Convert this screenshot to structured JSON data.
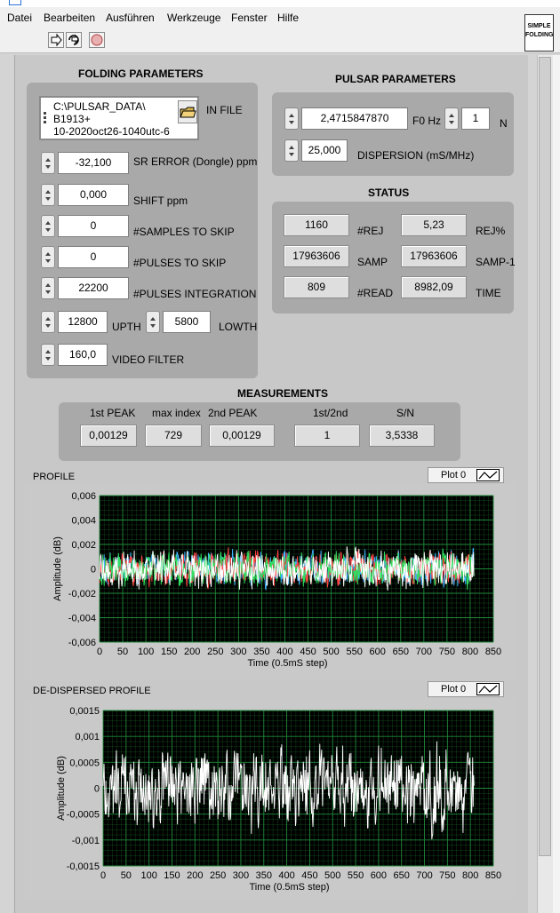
{
  "menu": [
    "Datei",
    "Bearbeiten",
    "Ausführen",
    "Werkzeuge",
    "Fenster",
    "Hilfe"
  ],
  "logo": {
    "line1": "SIMPLE",
    "line2": "FOLDING"
  },
  "folding": {
    "title": "FOLDING PARAMETERS",
    "in_file_label": "IN FILE",
    "in_file_lines": [
      "C:\\PULSAR_DATA\\",
      "B1913+",
      "10-2020oct26-1040utc-6"
    ],
    "sr_error": {
      "value": "-32,100",
      "label": "SR ERROR (Dongle) ppm"
    },
    "shift": {
      "value": "0,000",
      "label": "SHIFT ppm"
    },
    "samples_skip": {
      "value": "0",
      "label": "#SAMPLES TO SKIP"
    },
    "pulses_skip": {
      "value": "0",
      "label": "#PULSES TO SKIP"
    },
    "pulses_integration": {
      "value": "22200",
      "label": "#PULSES INTEGRATION"
    },
    "upth": {
      "value": "12800",
      "label": "UPTH"
    },
    "lowth": {
      "value": "5800",
      "label": "LOWTH"
    },
    "video_filter": {
      "value": "160,0",
      "label": "VIDEO FILTER"
    }
  },
  "pulsar": {
    "title": "PULSAR PARAMETERS",
    "f0": {
      "value": "2,4715847870",
      "label": "F0 Hz"
    },
    "n": {
      "value": "1",
      "label": "N"
    },
    "dispersion": {
      "value": "25,000",
      "label": "DISPERSION (mS/MHz)"
    }
  },
  "status": {
    "title": "STATUS",
    "rej": {
      "value": "1160",
      "label": "#REJ"
    },
    "rej_pct": {
      "value": "5,23",
      "label": "REJ%"
    },
    "samp": {
      "value": "17963606",
      "label": "SAMP"
    },
    "samp1": {
      "value": "17963606",
      "label": "SAMP-1"
    },
    "read": {
      "value": "809",
      "label": "#READ"
    },
    "time": {
      "value": "8982,09",
      "label": "TIME"
    }
  },
  "measurements": {
    "title": "MEASUREMENTS",
    "first_peak": {
      "label": "1st PEAK",
      "value": "0,00129"
    },
    "max_index": {
      "label": "max index",
      "value": "729"
    },
    "second_peak": {
      "label": "2nd PEAK",
      "value": "0,00129"
    },
    "ratio": {
      "label": "1st/2nd",
      "value": "1"
    },
    "sn": {
      "label": "S/N",
      "value": "3,5338"
    }
  },
  "chart_data": [
    {
      "type": "line",
      "title": "PROFILE",
      "legend": "Plot 0",
      "xlabel": "Time (0.5mS step)",
      "ylabel": "Amplitude (dB)",
      "xlim": [
        0,
        850
      ],
      "ylim": [
        -0.006,
        0.006
      ],
      "xticks": [
        0,
        50,
        100,
        150,
        200,
        250,
        300,
        350,
        400,
        450,
        500,
        550,
        600,
        650,
        700,
        750,
        800,
        850
      ],
      "xtick_labels": [
        "0",
        "50",
        "100",
        "150",
        "200",
        "250",
        "300",
        "350",
        "400",
        "450",
        "500",
        "550",
        "600",
        "650",
        "700",
        "750",
        "800",
        "850"
      ],
      "yticks": [
        0.006,
        0.004,
        0.002,
        0,
        -0.002,
        -0.004,
        -0.006
      ],
      "ytick_labels": [
        "0,006",
        "0,004",
        "0,002",
        "0",
        "-0,002",
        "-0,004",
        "-0,006"
      ],
      "grid": true,
      "plot_bg": "#000000",
      "grid_color": "#1f8a3a",
      "series": [
        {
          "color": "#3fb4ff",
          "amplitude": 0.0024,
          "n": 809
        },
        {
          "color": "#ff4040",
          "amplitude": 0.0022,
          "n": 809
        },
        {
          "color": "#30e060",
          "amplitude": 0.0022,
          "n": 809
        },
        {
          "color": "#ffffff",
          "amplitude": 0.0024,
          "n": 809
        }
      ]
    },
    {
      "type": "line",
      "title": "DE-DISPERSED PROFILE",
      "legend": "Plot 0",
      "xlabel": "Time (0.5mS step)",
      "ylabel": "Amplitude (dB)",
      "xlim": [
        0,
        850
      ],
      "ylim": [
        -0.0015,
        0.0015
      ],
      "xticks": [
        0,
        50,
        100,
        150,
        200,
        250,
        300,
        350,
        400,
        450,
        500,
        550,
        600,
        650,
        700,
        750,
        800,
        850
      ],
      "xtick_labels": [
        "0",
        "50",
        "100",
        "150",
        "200",
        "250",
        "300",
        "350",
        "400",
        "450",
        "500",
        "550",
        "600",
        "650",
        "700",
        "750",
        "800",
        "850"
      ],
      "yticks": [
        0.0015,
        0.001,
        0.0005,
        0,
        -0.0005,
        -0.001,
        -0.0015
      ],
      "ytick_labels": [
        "0,0015",
        "0,001",
        "0,0005",
        "0",
        "-0,0005",
        "-0,001",
        "-0,0015"
      ],
      "grid": true,
      "plot_bg": "#000000",
      "grid_color": "#1f8a3a",
      "series": [
        {
          "color": "#ffffff",
          "amplitude": 0.00125,
          "n": 809
        }
      ]
    }
  ]
}
